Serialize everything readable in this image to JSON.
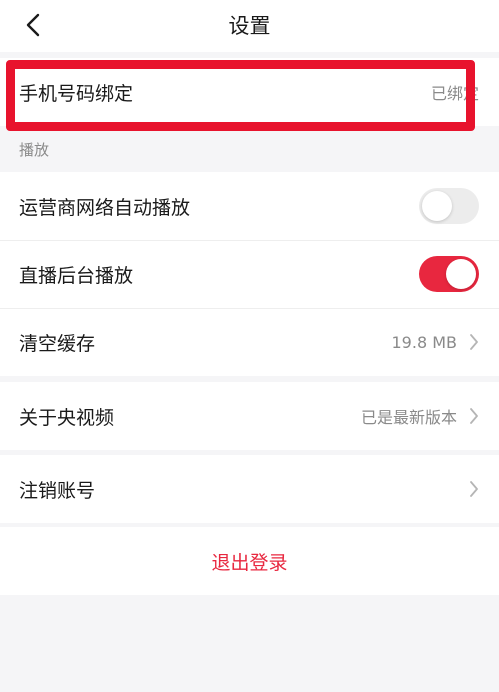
{
  "header": {
    "title": "设置",
    "back_icon": "chevron-left-icon"
  },
  "phone_binding": {
    "label": "手机号码绑定",
    "value": "已绑定"
  },
  "playback_group": {
    "title": "播放"
  },
  "carrier_autoplay": {
    "label": "运营商网络自动播放",
    "enabled": false
  },
  "background_play": {
    "label": "直播后台播放",
    "enabled": true
  },
  "clear_cache": {
    "label": "清空缓存",
    "value": "19.8 MB"
  },
  "about": {
    "label": "关于央视频",
    "value": "已是最新版本"
  },
  "cancel_account": {
    "label": "注销账号"
  },
  "logout": {
    "label": "退出登录"
  },
  "colors": {
    "accent": "#e8273f",
    "highlight": "#e8132d",
    "background": "#f5f5f7"
  }
}
